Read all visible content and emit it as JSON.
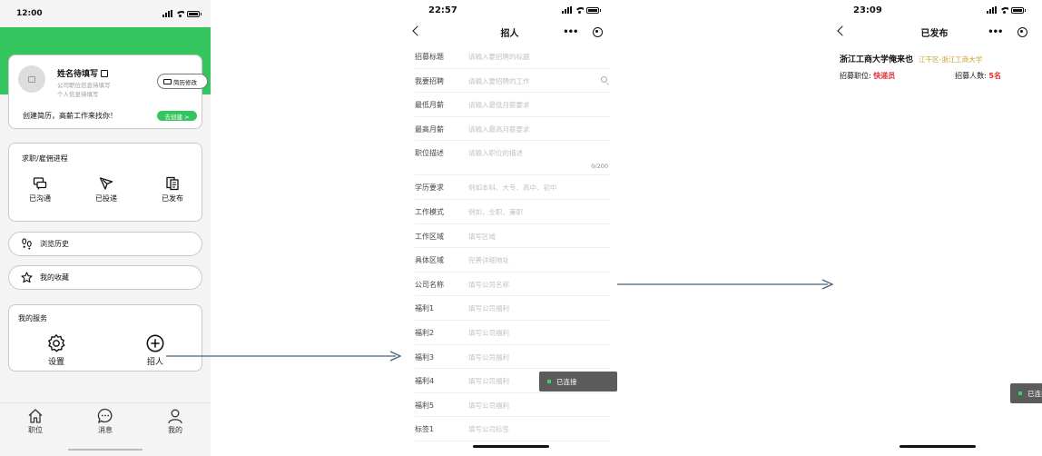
{
  "screen1": {
    "status": {
      "time": "12:00"
    },
    "profile": {
      "name": "姓名待填写",
      "sub1": "公司职位信息待填写",
      "sub2": "个人信息待填写",
      "resume_button": "简历修改",
      "create_text": "创建简历，高薪工作来找你！",
      "create_button": "去创建 >"
    },
    "progress": {
      "title": "求职/雇佣进程",
      "items": [
        {
          "label": "已沟通",
          "icon": "chat-icon"
        },
        {
          "label": "已投递",
          "icon": "send-icon"
        },
        {
          "label": "已发布",
          "icon": "document-icon"
        }
      ]
    },
    "history": {
      "label": "浏览历史",
      "icon": "footprint-icon"
    },
    "favorites": {
      "label": "我的收藏",
      "icon": "star-icon"
    },
    "services": {
      "title": "我的服务",
      "items": [
        {
          "label": "设置",
          "icon": "gear-icon"
        },
        {
          "label": "招人",
          "icon": "plus-circle-icon"
        }
      ]
    },
    "tabs": [
      {
        "label": "职位",
        "icon": "home-icon"
      },
      {
        "label": "消息",
        "icon": "message-icon"
      },
      {
        "label": "我的",
        "icon": "user-icon"
      }
    ],
    "accent": "#35c55e"
  },
  "screen2": {
    "status": {
      "time": "22:57"
    },
    "title": "招人",
    "fields": [
      {
        "label": "招募标题",
        "placeholder": "请输入要招聘的标题"
      },
      {
        "label": "我要招聘",
        "placeholder": "请输入要招聘的工作"
      },
      {
        "label": "最低月薪",
        "placeholder": "请输入最低月薪要求"
      },
      {
        "label": "最高月薪",
        "placeholder": "请输入最高月薪要求"
      },
      {
        "label": "职位描述",
        "placeholder": "请输入职位的描述",
        "counter": "0/200"
      },
      {
        "label": "学历要求",
        "placeholder": "例如本科、大专、高中、初中"
      },
      {
        "label": "工作模式",
        "placeholder": "例如，全职、兼职"
      },
      {
        "label": "工作区域",
        "placeholder": "填写区域"
      },
      {
        "label": "具体区域",
        "placeholder": "完善详细地址"
      },
      {
        "label": "公司名称",
        "placeholder": "填写公司名称"
      },
      {
        "label": "福利1",
        "placeholder": "填写公司福利"
      },
      {
        "label": "福利2",
        "placeholder": "填写公司福利"
      },
      {
        "label": "福利3",
        "placeholder": "填写公司福利"
      },
      {
        "label": "福利4",
        "placeholder": "填写公司福利"
      },
      {
        "label": "福利5",
        "placeholder": "填写公司福利"
      },
      {
        "label": "标签1",
        "placeholder": "填写公司标签"
      }
    ],
    "toast": "已连接"
  },
  "screen3": {
    "status": {
      "time": "23:09"
    },
    "title": "已发布",
    "job": {
      "title": "浙江工商大学俺来也",
      "location": "江干区-浙江工商大学",
      "position_label": "招募职位:",
      "position_value": "快递员",
      "count_label": "招募人数:",
      "count_value": "5名"
    },
    "toast": "已连接",
    "accent_gold": "#c9a227",
    "accent_red": "#e23030"
  }
}
